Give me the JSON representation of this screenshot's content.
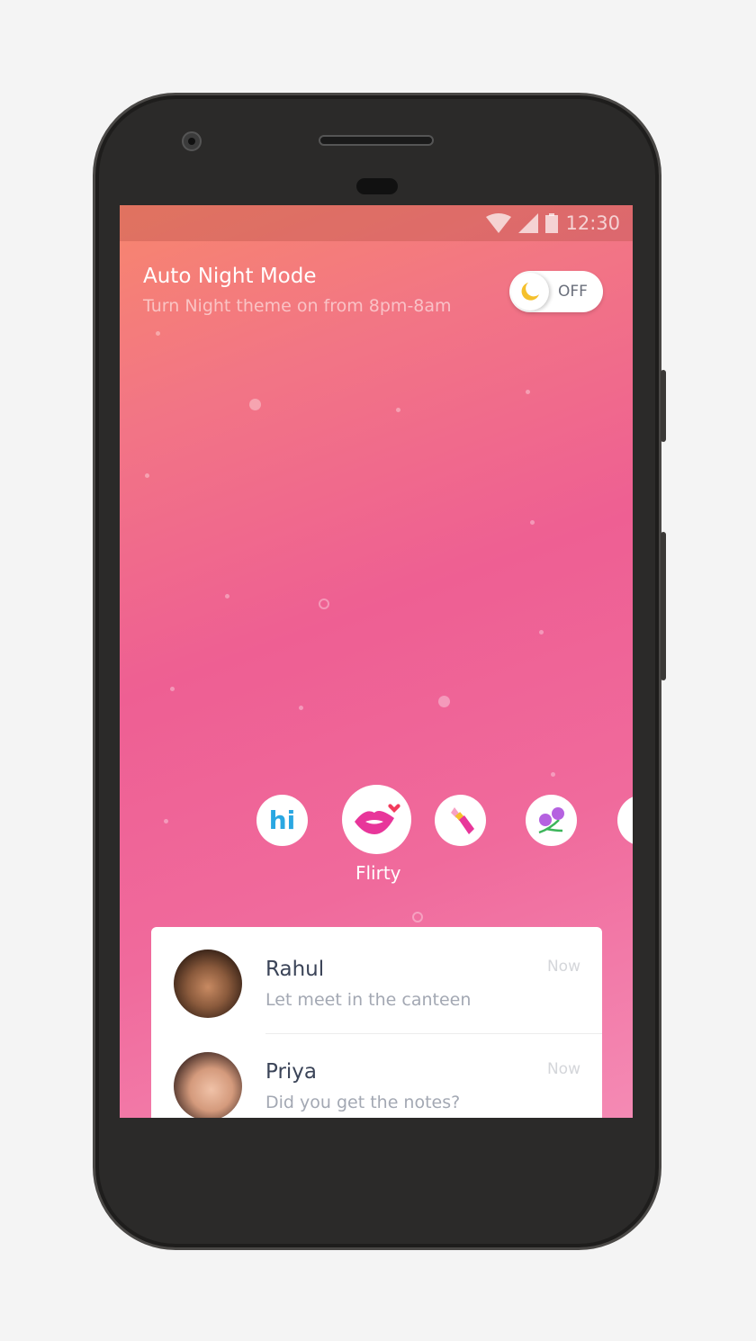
{
  "status_bar": {
    "time": "12:30",
    "icons": [
      "wifi-icon",
      "signal-icon",
      "battery-icon"
    ]
  },
  "night_mode": {
    "title": "Auto Night Mode",
    "subtitle": "Turn Night theme on from 8pm-8am",
    "toggle_label": "OFF",
    "toggle_on": false
  },
  "stickers": {
    "items": [
      {
        "name": "hi",
        "text": "hi"
      },
      {
        "name": "flirty",
        "label": "Flirty",
        "selected": true
      },
      {
        "name": "lipstick"
      },
      {
        "name": "flowers"
      },
      {
        "name": "more"
      }
    ],
    "selected_label": "Flirty"
  },
  "chats": [
    {
      "name": "Rahul",
      "message": "Let meet in the canteen",
      "time": "Now"
    },
    {
      "name": "Priya",
      "message": "Did you get the notes?",
      "time": "Now"
    }
  ],
  "colors": {
    "accent": "#ee5f93",
    "hi_blue": "#2aa7e2",
    "lips": "#e8369a"
  }
}
